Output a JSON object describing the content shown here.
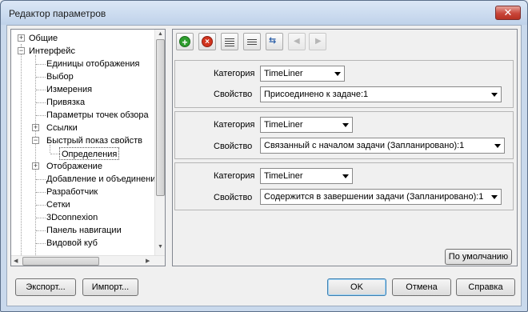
{
  "window": {
    "title": "Редактор параметров",
    "close_label": "✕"
  },
  "tree": {
    "items": [
      {
        "label": "Общие",
        "expander": "+"
      },
      {
        "label": "Интерфейс",
        "expander": "−"
      },
      {
        "label": "Единицы отображения"
      },
      {
        "label": "Выбор"
      },
      {
        "label": "Измерения"
      },
      {
        "label": "Привязка"
      },
      {
        "label": "Параметры точек обзора"
      },
      {
        "label": "Ссылки",
        "expander": "+"
      },
      {
        "label": "Быстрый показ свойств",
        "expander": "−"
      },
      {
        "label": "Определения",
        "selected": true
      },
      {
        "label": "Отображение",
        "expander": "+"
      },
      {
        "label": "Добавление и объединени"
      },
      {
        "label": "Разработчик"
      },
      {
        "label": "Сетки"
      },
      {
        "label": "3Dconnexion"
      },
      {
        "label": "Панель навигации"
      },
      {
        "label": "Видовой куб"
      }
    ]
  },
  "toolbar": {
    "add_icon": "plus-circle-icon",
    "remove_icon": "x-circle-icon"
  },
  "groups": [
    {
      "category_label": "Категория",
      "category_value": "TimeLiner",
      "property_label": "Свойство",
      "property_value": "Присоединено к задаче:1"
    },
    {
      "category_label": "Категория",
      "category_value": "TimeLiner",
      "property_label": "Свойство",
      "property_value": "Связанный с началом задачи (Запланировано):1"
    },
    {
      "category_label": "Категория",
      "category_value": "TimeLiner",
      "property_label": "Свойство",
      "property_value": "Содержится в завершении задачи (Запланировано):1"
    }
  ],
  "buttons": {
    "defaults": "По умолчанию",
    "export": "Экспорт...",
    "import": "Импорт...",
    "ok": "OK",
    "cancel": "Отмена",
    "help": "Справка"
  },
  "colors": {
    "add": "#2e9e2e",
    "remove": "#d2351f",
    "title_bar": "#c9d9ec"
  }
}
